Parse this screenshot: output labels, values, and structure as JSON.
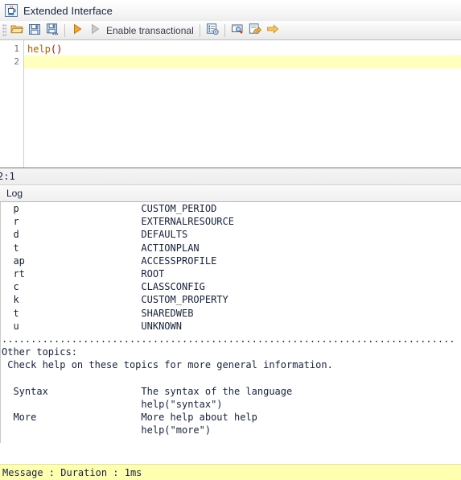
{
  "window": {
    "title": "Extended Interface",
    "icon": "java-cup-icon"
  },
  "toolbar": {
    "open_label": "",
    "save_label": "",
    "save_as_label": "",
    "run_label": "",
    "run_step_label": "",
    "transactional_label": "Enable transactional",
    "properties_label": "",
    "inspect_label": "",
    "export_label": "",
    "next_label": "",
    "icons": {
      "open": "folder-open-icon",
      "save": "save-icon",
      "save_as": "save-as-icon",
      "run": "run-icon",
      "run_step": "run-step-icon",
      "properties": "properties-icon",
      "inspect": "inspect-icon",
      "export": "export-icon",
      "next": "arrow-right-icon"
    }
  },
  "editor": {
    "lines": [
      {
        "number": "1",
        "text": "help()",
        "current": false
      },
      {
        "number": "2",
        "text": "",
        "current": true
      }
    ],
    "line1_fn": "help",
    "line1_paren": "()"
  },
  "statusbar": {
    "cursor_position": "2:1"
  },
  "log_panel": {
    "tab_label": "Log",
    "lines": [
      "  p                     CUSTOM_PERIOD",
      "  r                     EXTERNALRESOURCE",
      "  d                     DEFAULTS",
      "  t                     ACTIONPLAN",
      "  ap                    ACCESSPROFILE",
      "  rt                    ROOT",
      "  c                     CLASSCONFIG",
      "  k                     CUSTOM_PROPERTY",
      "  t                     SHAREDWEB",
      "  u                     UNKNOWN",
      "..............................................................................",
      "Other topics:",
      " Check help on these topics for more general information.",
      "",
      "  Syntax                The syntax of the language",
      "                        help(\"syntax\")",
      "  More                  More help about help",
      "                        help(\"more\")",
      "",
      "=============================================================================="
    ]
  },
  "message_bar": {
    "text": "Message : Duration : 1ms"
  },
  "colors": {
    "accent_orange": "#f29b2e",
    "highlight_yellow": "#ffffbe",
    "message_yellow": "#ffffb0",
    "code_function": "#b06000",
    "code_paren": "#d00000",
    "text": "#16213e"
  }
}
